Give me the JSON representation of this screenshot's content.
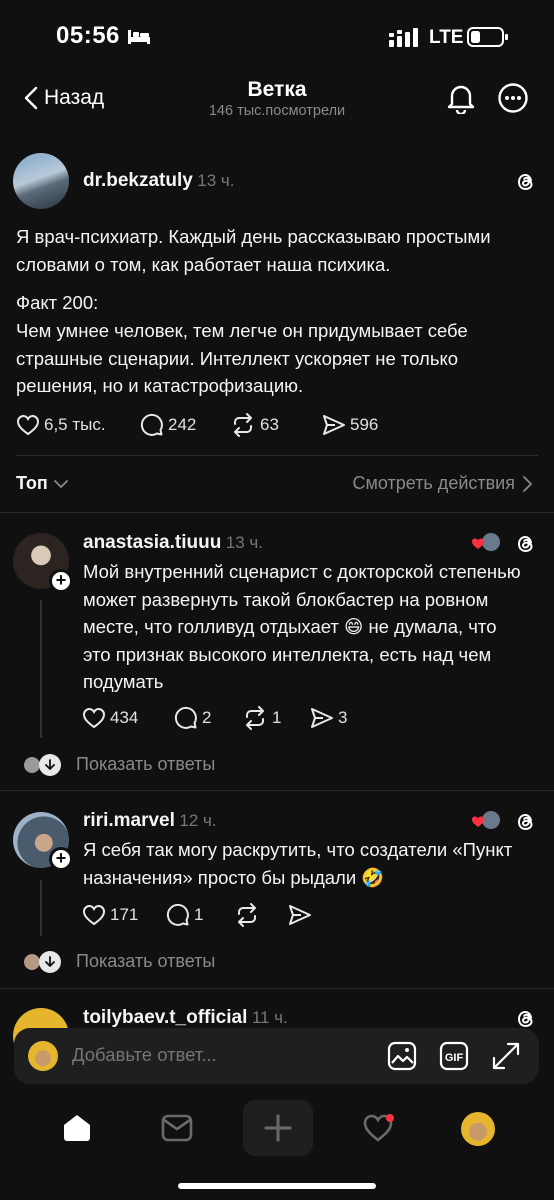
{
  "status_bar": {
    "time": "05:56",
    "network": "LTE"
  },
  "header": {
    "back_label": "Назад",
    "title": "Ветка",
    "subtitle": "146 тыс.посмотрели"
  },
  "post": {
    "username": "dr.bekzatuly",
    "time": "13 ч.",
    "text_intro": "Я  врач-психиатр. Каждый день рассказываю простыми словами о том, как работает наша психика.",
    "fact_title": "Факт 200:",
    "fact_text": "Чем умнее человек, тем легче он придумывает себе страшные сценарии. Интеллект ускоряет не только решения, но и катастрофизацию.",
    "likes": "6,5 тыс.",
    "comments": "242",
    "reposts": "63",
    "shares": "596"
  },
  "sort": {
    "label": "Топ",
    "activity_label": "Смотреть действия"
  },
  "replies": [
    {
      "username": "anastasia.tiuuu",
      "time": "13 ч.",
      "text": "Мой внутренний сценарист с докторской степенью может развернуть такой блокбастер на ровном месте, что голливуд отдыхает 😄 не думала, что это признак высокого интеллекта, есть над чем подумать",
      "likes": "434",
      "comments": "2",
      "reposts": "1",
      "shares": "3",
      "show_replies": "Показать ответы"
    },
    {
      "username": "riri.marvel",
      "time": "12 ч.",
      "text": "Я себя так могу раскрутить, что создатели «Пункт назначения» просто бы рыдали 🤣",
      "likes": "171",
      "comments": "1",
      "show_replies": "Показать ответы"
    },
    {
      "username": "toilybaev.t_official",
      "time": "11 ч."
    }
  ],
  "composer": {
    "placeholder": "Добавьте ответ..."
  },
  "colors": {
    "background": "#101010",
    "text": "#f3f5f7",
    "muted": "#8a8a8a",
    "like_red": "#ff3040"
  }
}
